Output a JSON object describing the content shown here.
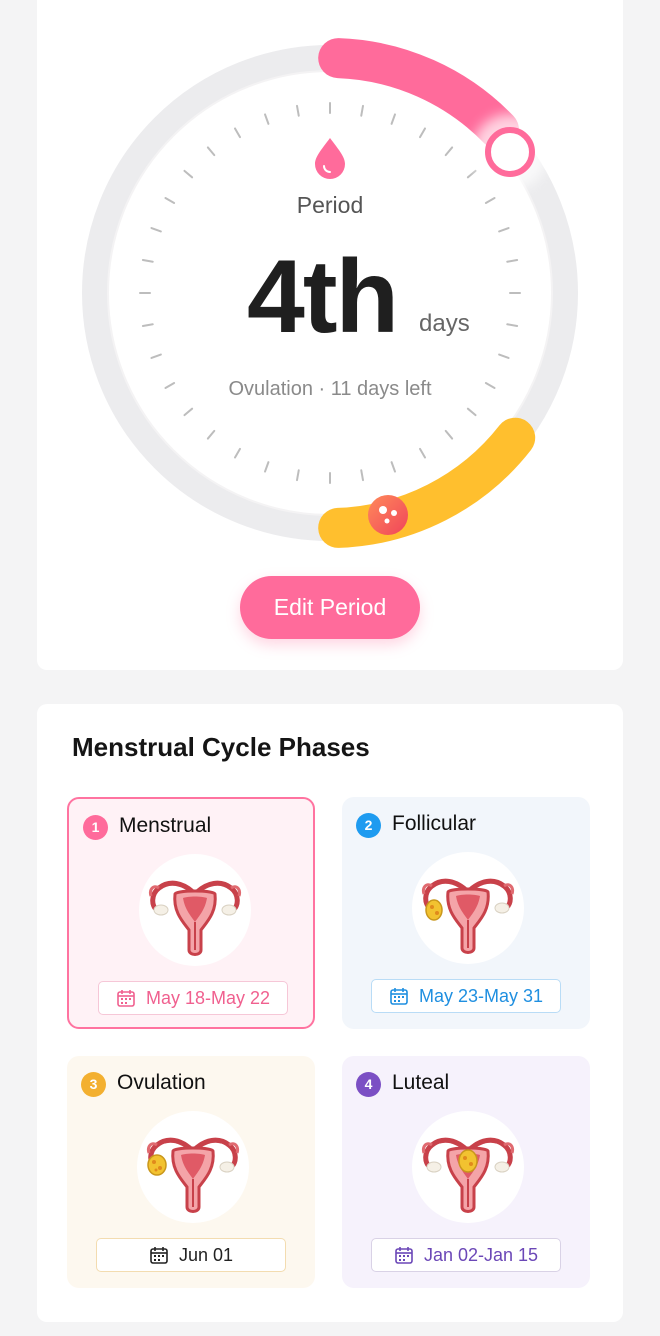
{
  "gauge": {
    "phase_label": "Period",
    "day_number": "4th",
    "day_unit": "days",
    "ovulation_info": "Ovulation · 11 days left",
    "colors": {
      "period": "#ff6b9b",
      "fertile": "#ffbf2e",
      "track": "#e9e7ea"
    }
  },
  "edit_button": {
    "label": "Edit Period"
  },
  "phases": {
    "title": "Menstrual Cycle Phases",
    "items": [
      {
        "number": "1",
        "name": "Menstrual",
        "dates": "May 18-May 22",
        "color": "#ff6b9b"
      },
      {
        "number": "2",
        "name": "Follicular",
        "dates": "May 23-May 31",
        "color": "#1e9bf0"
      },
      {
        "number": "3",
        "name": "Ovulation",
        "dates": "Jun 01",
        "color": "#f3b030"
      },
      {
        "number": "4",
        "name": "Luteal",
        "dates": "Jan 02-Jan 15",
        "color": "#7b4fc4"
      }
    ]
  }
}
